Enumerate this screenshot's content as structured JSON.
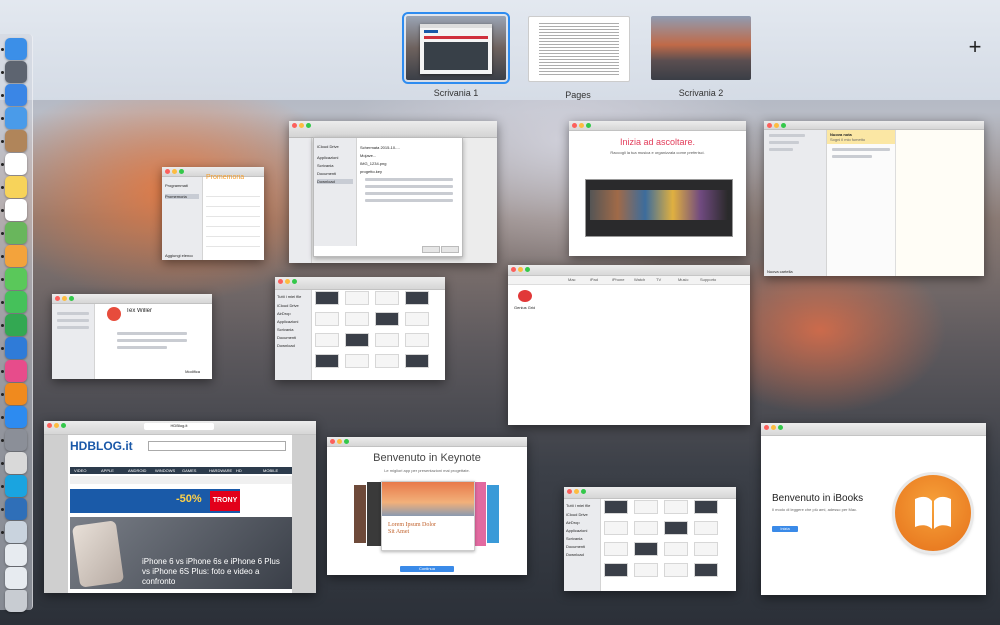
{
  "spaces": [
    {
      "label": "Scrivania 1",
      "selected": true
    },
    {
      "label": "Pages",
      "selected": false
    },
    {
      "label": "Scrivania 2",
      "selected": false
    }
  ],
  "add_space_glyph": "+",
  "dock": {
    "icons": [
      "finder-icon",
      "launchpad-icon",
      "safari-icon",
      "mail-icon",
      "contacts-icon",
      "calendar-icon",
      "notes-icon",
      "reminders-icon",
      "maps-icon",
      "photos-icon",
      "messages-icon",
      "facetime-icon",
      "numbers-icon",
      "keynote-icon",
      "itunes-icon",
      "ibooks-icon",
      "app-store-icon",
      "system-preferences-icon",
      "notification-icon",
      "skype-icon",
      "xcode-icon",
      "finder-window-icon",
      "document-icon",
      "document-icon-2",
      "trash-icon"
    ],
    "colors": [
      "#3b8fe8",
      "#5d6470",
      "#3a86e6",
      "#4a9be9",
      "#b0855a",
      "#ffffff",
      "#f7d35a",
      "#ffffff",
      "#69b65c",
      "#f3a33c",
      "#5ac85a",
      "#45c15a",
      "#33a852",
      "#2f7bd8",
      "#e74c8b",
      "#f08a1e",
      "#2d8bf0",
      "#8b8f98",
      "#d9d9d9",
      "#1aa4e0",
      "#2f6fb8",
      "#c9d3de",
      "#e7ebf0",
      "#e7ebf0",
      "#c8ccd2"
    ]
  },
  "windows": {
    "reminders": {
      "title": "Promemoria",
      "items": [
        "Programmati",
        "Promemoria"
      ],
      "footer": "Aggiungi elenco"
    },
    "finder_large": {
      "sidebar": [
        "iCloud Drive",
        "Applicazioni",
        "Scrivania",
        "Documenti",
        "Download"
      ],
      "files": [
        "Schermata 2015-10-...",
        "Mojave...",
        "IMG_1234.png",
        "progetto.key"
      ]
    },
    "itunes": {
      "headline": "Inizia ad ascoltare.",
      "sub": "Raccogli la tua musica e organizzala come preferisci."
    },
    "notes": {
      "note_title": "Nuova nota",
      "note_preview": "Sogni il mio fumetto",
      "footer": "Nuova cartella"
    },
    "contacts": {
      "name": "Tex Willer",
      "footer": "Modifica"
    },
    "finder_mid": {
      "sidebar": [
        "Tutti i miei file",
        "iCloud Drive",
        "AirDrop",
        "Applicazioni",
        "Scrivania",
        "Documenti",
        "Download"
      ]
    },
    "apple_site": {
      "nav": [
        "Mac",
        "iPad",
        "iPhone",
        "Watch",
        "TV",
        "Music",
        "Supporto"
      ],
      "badge": "Genius Grid"
    },
    "safari_hdblog": {
      "tab": "HDBlog.it",
      "logo": "HDBLOG.it",
      "nav": [
        "VIDEO",
        "APPLE",
        "ANDROID",
        "WINDOWS",
        "GAMES",
        "HARDWARE",
        "HD",
        "MOBILE"
      ],
      "banner": "-50%",
      "brand": "TRONY",
      "headline": "iPhone 6 vs iPhone 6s e iPhone 6 Plus vs iPhone 6S Plus: foto e video a confronto"
    },
    "keynote": {
      "title": "Benvenuto in Keynote",
      "sub": "Le migliori app per presentazioni mai progettate.",
      "slide_title": "Lorem Ipsum Dolor Sit Amet",
      "button": "Continua"
    },
    "finder_small": {
      "sidebar": [
        "Tutti i miei file",
        "iCloud Drive",
        "AirDrop",
        "Applicazioni",
        "Scrivania",
        "Documenti",
        "Download"
      ]
    },
    "ibooks": {
      "title": "Benvenuto in iBooks",
      "sub": "Il modo di leggere che più ami, adesso per Mac.",
      "button": "Inizia"
    }
  }
}
